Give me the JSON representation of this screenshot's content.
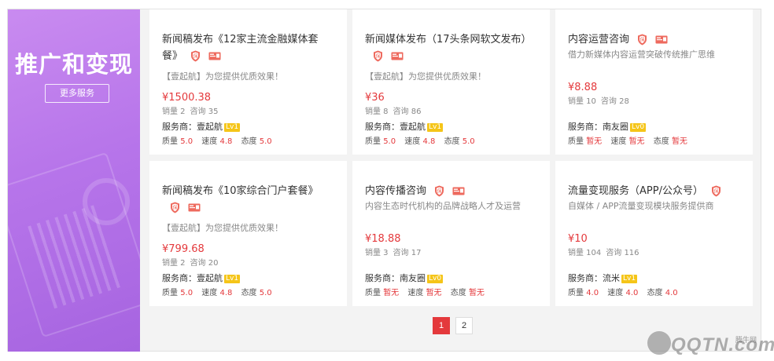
{
  "promo": {
    "title": "推广和变现",
    "more_label": "更多服务"
  },
  "cards": [
    {
      "title": "新闻稿发布《12家主流金融媒体套餐》",
      "desc": "【壹起航】为您提供优质效果！",
      "price": "¥1500.38",
      "sales": "销量 2",
      "consult": "咨询 35",
      "provider_label": "服务商：壹起航",
      "level": "Lv1",
      "quality": "5.0",
      "speed": "4.8",
      "attitude": "5.0"
    },
    {
      "title": "新闻媒体发布（17头条网软文发布）",
      "desc": "【壹起航】为您提供优质效果！",
      "price": "¥36",
      "sales": "销量 8",
      "consult": "咨询 86",
      "provider_label": "服务商：壹起航",
      "level": "Lv1",
      "quality": "5.0",
      "speed": "4.8",
      "attitude": "5.0"
    },
    {
      "title": "内容运营咨询",
      "desc": "借力新媒体内容运营突破传统推广思维",
      "price": "¥8.88",
      "sales": "销量 10",
      "consult": "咨询 28",
      "provider_label": "服务商：南友圈",
      "level": "Lv0",
      "quality": "暂无",
      "speed": "暂无",
      "attitude": "暂无"
    },
    {
      "title": "新闻稿发布《10家综合门户套餐》",
      "desc": "【壹起航】为您提供优质效果！",
      "price": "¥799.68",
      "sales": "销量 2",
      "consult": "咨询 20",
      "provider_label": "服务商：壹起航",
      "level": "Lv1",
      "quality": "5.0",
      "speed": "4.8",
      "attitude": "5.0"
    },
    {
      "title": "内容传播咨询",
      "desc": "内容生态时代机构的品牌战略人才及运营",
      "price": "¥18.88",
      "sales": "销量 3",
      "consult": "咨询 17",
      "provider_label": "服务商：南友圈",
      "level": "Lv0",
      "quality": "暂无",
      "speed": "暂无",
      "attitude": "暂无"
    },
    {
      "title": "流量变现服务（APP/公众号）",
      "desc": "自媒体 / APP流量变现模块服务提供商",
      "price": "¥10",
      "sales": "销量 104",
      "consult": "咨询 116",
      "provider_label": "服务商：流米",
      "level": "Lv1",
      "quality": "4.0",
      "speed": "4.0",
      "attitude": "4.0"
    }
  ],
  "rating_labels": {
    "quality": "质量",
    "speed": "速度",
    "attitude": "态度"
  },
  "pagination": {
    "pages": [
      "1",
      "2"
    ],
    "current": "1"
  },
  "watermark": {
    "brand": "QQTN.com",
    "site": "腾牛网"
  },
  "colors": {
    "accent_red": "#e4393c",
    "promo_purple": "#b775ea",
    "level_yellow": "#f5c518"
  }
}
